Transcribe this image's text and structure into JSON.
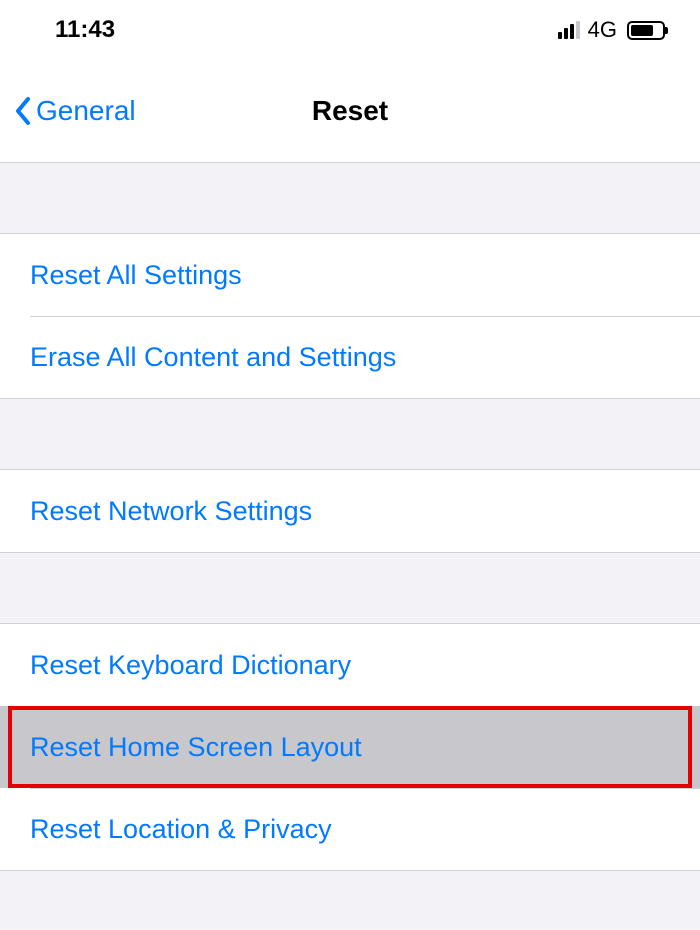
{
  "status_bar": {
    "time": "11:43",
    "network_label": "4G"
  },
  "nav": {
    "back_label": "General",
    "title": "Reset"
  },
  "groups": [
    {
      "items": [
        {
          "label": "Reset All Settings",
          "name": "reset-all-settings"
        },
        {
          "label": "Erase All Content and Settings",
          "name": "erase-all-content-and-settings"
        }
      ]
    },
    {
      "items": [
        {
          "label": "Reset Network Settings",
          "name": "reset-network-settings"
        }
      ]
    },
    {
      "items": [
        {
          "label": "Reset Keyboard Dictionary",
          "name": "reset-keyboard-dictionary"
        },
        {
          "label": "Reset Home Screen Layout",
          "name": "reset-home-screen-layout",
          "highlighted": true
        },
        {
          "label": "Reset Location & Privacy",
          "name": "reset-location-privacy"
        }
      ]
    }
  ]
}
